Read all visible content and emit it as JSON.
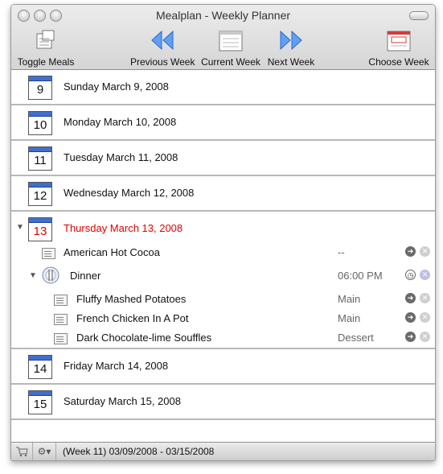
{
  "window": {
    "title": "Mealplan - Weekly Planner"
  },
  "toolbar": {
    "toggle_meals": "Toggle Meals",
    "previous_week": "Previous Week",
    "current_week": "Current Week",
    "next_week": "Next Week",
    "choose_week": "Choose Week"
  },
  "days": [
    {
      "num": "9",
      "label": "Sunday March 9, 2008"
    },
    {
      "num": "10",
      "label": "Monday March 10, 2008"
    },
    {
      "num": "11",
      "label": "Tuesday March 11, 2008"
    },
    {
      "num": "12",
      "label": "Wednesday March 12, 2008"
    },
    {
      "num": "13",
      "label": "Thursday March 13, 2008"
    },
    {
      "num": "14",
      "label": "Friday March 14, 2008"
    },
    {
      "num": "15",
      "label": "Saturday March 15, 2008"
    }
  ],
  "thursday_items": {
    "cocoa": {
      "name": "American Hot Cocoa",
      "value": "--"
    },
    "dinner": {
      "name": "Dinner",
      "time": "06:00 PM"
    },
    "recipes": [
      {
        "name": "Fluffy Mashed Potatoes",
        "course": "Main"
      },
      {
        "name": "French Chicken In A Pot",
        "course": "Main"
      },
      {
        "name": "Dark Chocolate-lime Souffles",
        "course": "Dessert"
      }
    ]
  },
  "statusbar": {
    "week_range": "(Week 11) 03/09/2008 - 03/15/2008"
  },
  "colors": {
    "today": "#e00000",
    "calendar_header": "#3f6fcf",
    "arrow_blue": "#3a7fe0"
  }
}
